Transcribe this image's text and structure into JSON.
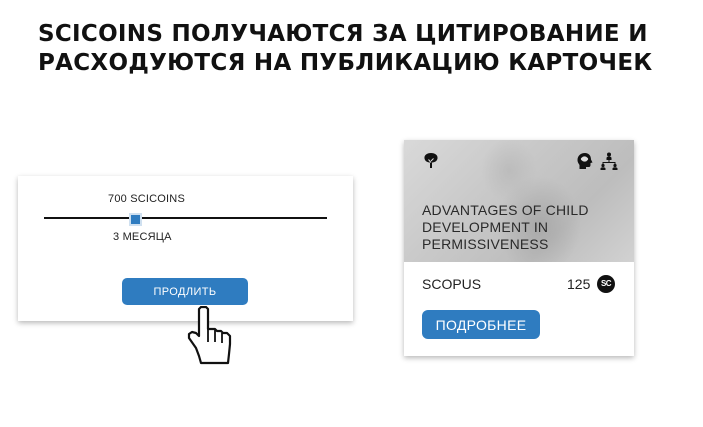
{
  "headline": {
    "line1": "SCICOINS ПОЛУЧАЮТСЯ ЗА ЦИТИРОВАНИЕ И",
    "line2": "РАСХОДУЮТСЯ НА ПУБЛИКАЦИЮ КАРТОЧЕК"
  },
  "renewal": {
    "price": "700 SCICOINS",
    "period": "3 МЕСЯЦА",
    "button_label": "ПРОДЛИТЬ",
    "slider_fraction": 0.32
  },
  "card": {
    "title_line1": "ADVANTAGES OF CHILD",
    "title_line2": "DEVELOPMENT IN",
    "title_line3": "PERMISSIVENESS",
    "source": "SCOPUS",
    "citations": "125",
    "coin_label": "SC",
    "more_button": "ПОДРОБНЕЕ",
    "icons": [
      "tree-icon",
      "head-brain-icon",
      "team-icon",
      "scicoin-icon"
    ]
  },
  "colors": {
    "accent": "#2f7cc0",
    "text": "#1a1a1a"
  }
}
